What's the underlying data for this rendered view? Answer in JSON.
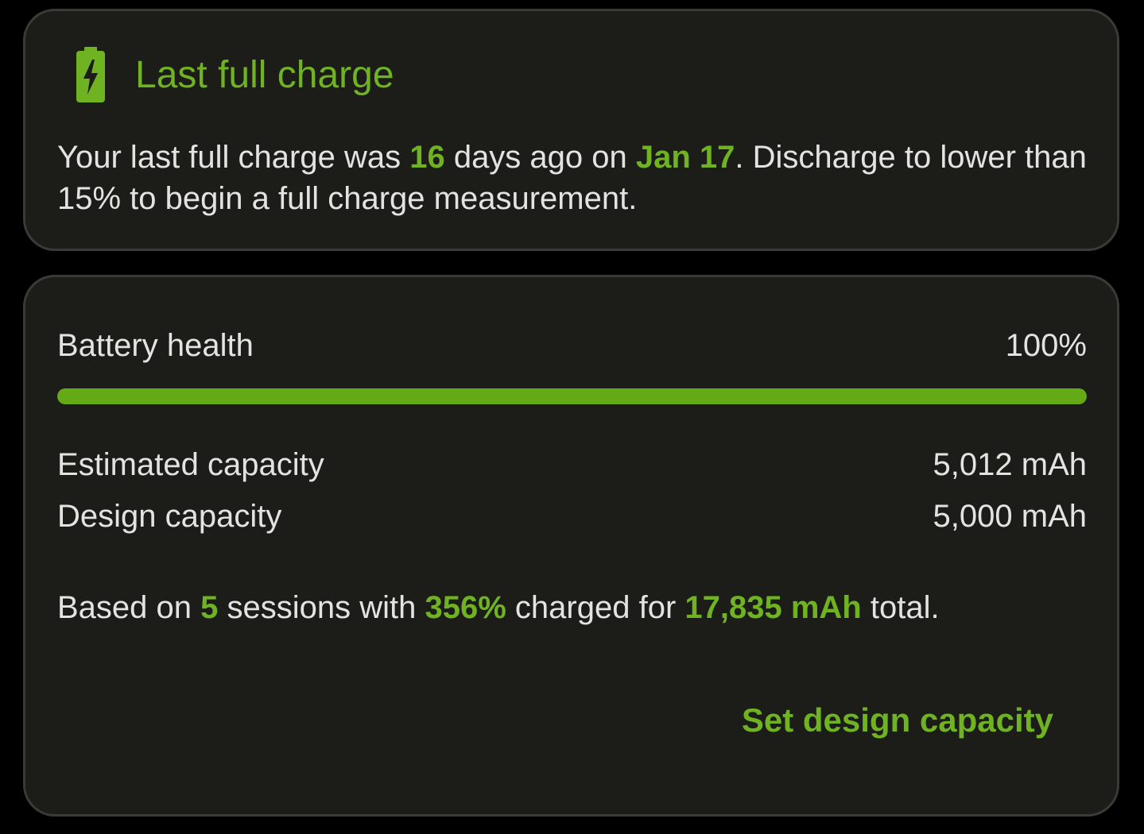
{
  "last_charge": {
    "title": "Last full charge",
    "text_1": "Your last full charge was ",
    "days": "16",
    "text_2": " days ago on ",
    "date": "Jan 17",
    "text_3": ". Discharge to lower than 15% to begin a full charge measurement."
  },
  "health": {
    "label": "Battery health",
    "value": "100%",
    "progress_fraction": 1.0,
    "estimated_label": "Estimated capacity",
    "estimated_value": "5,012 mAh",
    "design_label": "Design capacity",
    "design_value": "5,000 mAh",
    "sessions_1": "Based on ",
    "sessions_count": "5",
    "sessions_2": " sessions with ",
    "sessions_percent": "356%",
    "sessions_3": " charged for ",
    "sessions_mah": "17,835 mAh",
    "sessions_4": " total.",
    "set_design_label": "Set design capacity"
  },
  "colors": {
    "accent": "#6fb323",
    "card_bg": "#1c1d19",
    "text": "#e3e3e1"
  },
  "icons": {
    "header": "battery-charging-icon"
  }
}
